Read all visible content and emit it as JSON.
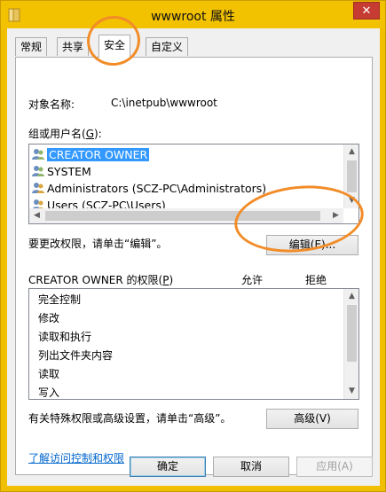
{
  "window": {
    "title": "wwwroot 属性",
    "close_glyph": "✕"
  },
  "tabs": [
    {
      "label": "常规"
    },
    {
      "label": "共享"
    },
    {
      "label": "安全"
    },
    {
      "label": "自定义"
    }
  ],
  "object": {
    "label": "对象名称:",
    "value": "C:\\inetpub\\wwwroot"
  },
  "group": {
    "label_prefix": "组或用户名(",
    "label_key": "G",
    "label_suffix": "):",
    "items": [
      {
        "name": "CREATOR OWNER",
        "selected": true
      },
      {
        "name": "SYSTEM"
      },
      {
        "name": "Administrators (SCZ-PC\\Administrators)"
      },
      {
        "name": "Users (SCZ-PC\\Users)"
      }
    ]
  },
  "edit": {
    "hint": "要更改权限，请单击“编辑”。",
    "button_label": "编辑(E)..."
  },
  "permissions": {
    "label_prefix": "CREATOR OWNER 的权限(",
    "label_key": "P",
    "label_suffix": ")",
    "allow_header": "允许",
    "deny_header": "拒绝",
    "items": [
      "完全控制",
      "修改",
      "读取和执行",
      "列出文件夹内容",
      "读取",
      "写入"
    ]
  },
  "advanced": {
    "hint": "有关特殊权限或高级设置，请单击“高级”。",
    "button_label": "高级(V)"
  },
  "link": {
    "label": "了解访问控制和权限"
  },
  "footer": {
    "ok_label": "确定",
    "cancel_label": "取消",
    "apply_label": "应用(A)"
  },
  "colors": {
    "titlebar": "#f2c100",
    "selection": "#3399ff",
    "annotation": "#f28c28",
    "link": "#0066cc"
  }
}
